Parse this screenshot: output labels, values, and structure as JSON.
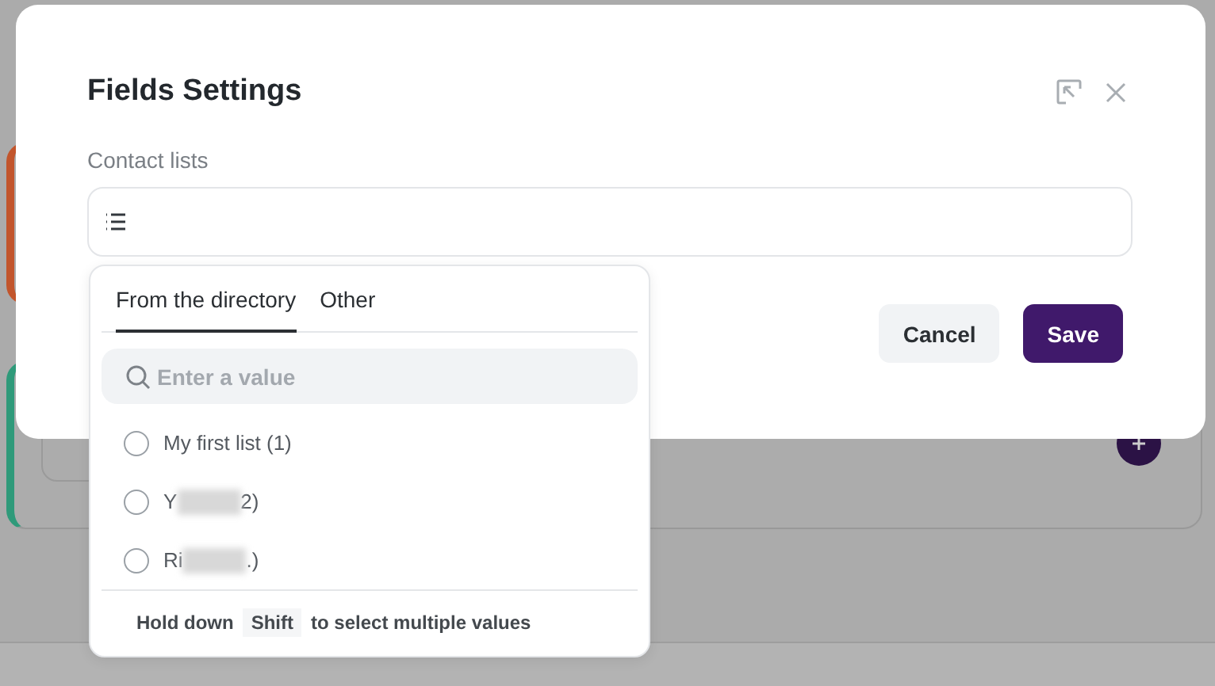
{
  "dialog": {
    "title": "Fields Settings",
    "field_label": "Contact lists",
    "buttons": [
      {
        "label": "Cancel",
        "kind": "secondary"
      },
      {
        "label": "Save",
        "kind": "primary"
      }
    ]
  },
  "dropdown": {
    "tabs": [
      {
        "label": "From the directory",
        "selected": true
      },
      {
        "label": "Other",
        "selected": false
      }
    ],
    "search": {
      "placeholder": "Enter a value"
    },
    "options": [
      {
        "label_start": "My first list (1)",
        "redacted": false,
        "checked": false
      },
      {
        "label_start": "Y",
        "label_end": "2)",
        "redacted": true,
        "checked": false
      },
      {
        "label_start": "Ri",
        "label_end": ".)",
        "redacted": true,
        "checked": false
      }
    ],
    "hint": {
      "before": "Hold down",
      "key": "Shift",
      "after": "to select multiple values"
    }
  }
}
